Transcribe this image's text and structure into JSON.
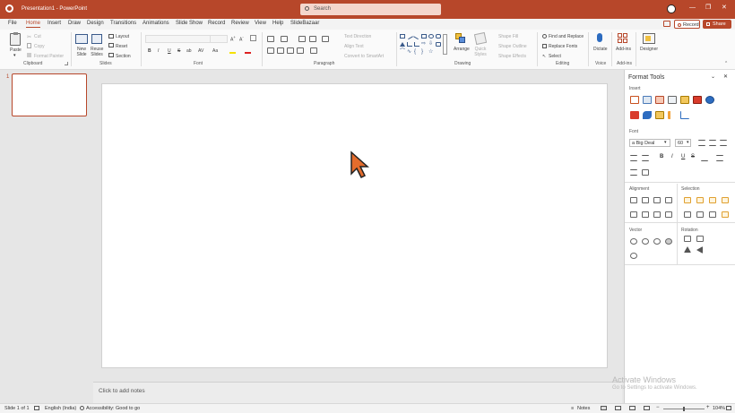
{
  "titlebar": {
    "app_title": "Presentation1 - PowerPoint",
    "search_placeholder": "Search",
    "user_initial": "",
    "minimize_glyph": "—",
    "restore_glyph": "❐",
    "close_glyph": "✕"
  },
  "tabs": [
    {
      "label": "File"
    },
    {
      "label": "Home",
      "active": true
    },
    {
      "label": "Insert"
    },
    {
      "label": "Draw"
    },
    {
      "label": "Design"
    },
    {
      "label": "Transitions"
    },
    {
      "label": "Animations"
    },
    {
      "label": "Slide Show"
    },
    {
      "label": "Record"
    },
    {
      "label": "Review"
    },
    {
      "label": "View"
    },
    {
      "label": "Help"
    },
    {
      "label": "SlideBazaar"
    }
  ],
  "tab_right": {
    "record_label": "Record",
    "share_label": "Share"
  },
  "ribbon": {
    "clipboard": {
      "paste": "Paste",
      "cut": "Cut",
      "copy": "Copy",
      "format_painter": "Format Painter",
      "group": "Clipboard"
    },
    "slides": {
      "new_slide": "New Slide",
      "reuse_slides": "Reuse Slides",
      "layout": "Layout",
      "reset": "Reset",
      "section": "Section",
      "group": "Slides"
    },
    "font": {
      "group": "Font",
      "bold": "B",
      "italic": "I",
      "underline": "U",
      "strike": "S",
      "shadow": "ab",
      "spacing": "AV",
      "case": "Aa"
    },
    "paragraph": {
      "group": "Paragraph",
      "text_direction": "Text Direction",
      "align_text": "Align Text",
      "convert_smartart": "Convert to SmartArt"
    },
    "drawing": {
      "group": "Drawing",
      "arrange": "Arrange",
      "quick_styles": "Quick Styles",
      "shape_fill": "Shape Fill",
      "shape_outline": "Shape Outline",
      "shape_effects": "Shape Effects"
    },
    "editing": {
      "group": "Editing",
      "find_replace": "Find and Replace",
      "replace_fonts": "Replace Fonts",
      "select": "Select"
    },
    "voice": {
      "group": "Voice",
      "dictate": "Dictate"
    },
    "addins": {
      "group": "Add-ins",
      "addins": "Add-ins"
    },
    "designer": {
      "designer": "Designer"
    }
  },
  "thumbnail": {
    "number": "1"
  },
  "notes_placeholder": "Click to add notes",
  "format_tools": {
    "title": "Format Tools",
    "insert_label": "Insert",
    "font_label": "Font",
    "font_name": "a Big Deal",
    "font_size": "60",
    "alignment_label": "Alignment",
    "selection_label": "Selection",
    "vector_label": "Vector",
    "rotation_label": "Rotation"
  },
  "watermark": {
    "line1": "Activate Windows",
    "line2": "Go to Settings to activate Windows."
  },
  "status": {
    "slide": "Slide 1 of 1",
    "language": "English (India)",
    "accessibility": "Accessibility: Good to go",
    "notes": "Notes",
    "zoom": "104%"
  },
  "colors": {
    "brand": "#b7472a",
    "accent_orange": "#e46c2c"
  }
}
